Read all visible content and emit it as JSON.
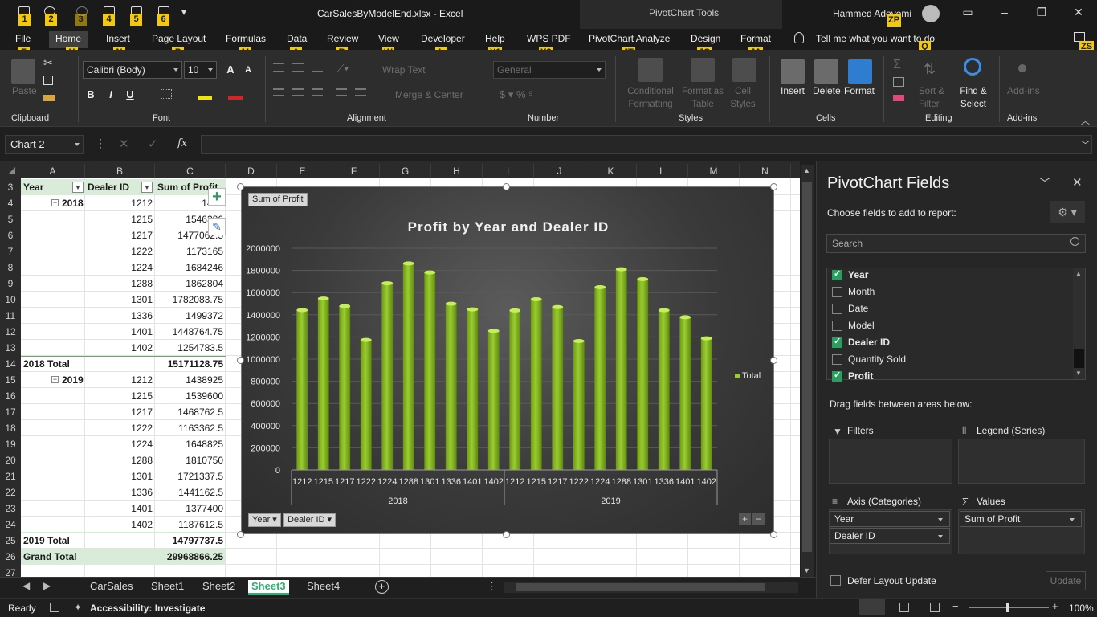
{
  "window": {
    "doc_title": "CarSalesByModelEnd.xlsx  -  Excel",
    "tools_label": "PivotChart Tools",
    "user_name": "Hammed Adeyemi",
    "qat_keytips": [
      "1",
      "2",
      "3",
      "4",
      "5",
      "6"
    ]
  },
  "tabs": [
    {
      "label": "File",
      "key": "F"
    },
    {
      "label": "Home",
      "key": "H"
    },
    {
      "label": "Insert",
      "key": "N"
    },
    {
      "label": "Page Layout",
      "key": "P"
    },
    {
      "label": "Formulas",
      "key": "M"
    },
    {
      "label": "Data",
      "key": "A"
    },
    {
      "label": "Review",
      "key": "R"
    },
    {
      "label": "View",
      "key": "W"
    },
    {
      "label": "Developer",
      "key": "L"
    },
    {
      "label": "Help",
      "key": "Y1"
    },
    {
      "label": "WPS PDF",
      "key": "Y2"
    },
    {
      "label": "PivotChart Analyze",
      "key": "JT"
    },
    {
      "label": "Design",
      "key": "JC"
    },
    {
      "label": "Format",
      "key": "JA"
    }
  ],
  "tell_me": "Tell me what you want to do",
  "keytips_extra": {
    "zp": "ZP",
    "q": "Q",
    "zs": "ZS"
  },
  "ribbon": {
    "paste": "Paste",
    "font_name": "Calibri (Body)",
    "font_size": "10",
    "wrap_text": "Wrap Text",
    "merge_center": "Merge & Center",
    "number_format": "General",
    "conditional_formatting": "Conditional Formatting",
    "format_as_table": "Format as Table",
    "cell_styles": "Cell Styles",
    "insert": "Insert",
    "delete": "Delete",
    "format": "Format",
    "sort_filter": "Sort & Filter",
    "find_select": "Find & Select",
    "add_ins": "Add-ins",
    "groups": {
      "clipboard": "Clipboard",
      "font": "Font",
      "alignment": "Alignment",
      "number": "Number",
      "styles": "Styles",
      "cells": "Cells",
      "editing": "Editing",
      "add_ins": "Add-ins"
    },
    "bold": "B",
    "italic": "I",
    "underline": "U"
  },
  "formula_bar": {
    "name_box": "Chart 2",
    "fx": "fx",
    "value": ""
  },
  "grid": {
    "columns": [
      "A",
      "B",
      "C",
      "D",
      "E",
      "F",
      "G",
      "H",
      "I",
      "J",
      "K",
      "L",
      "M",
      "N"
    ],
    "rows": [
      "3",
      "4",
      "5",
      "6",
      "7",
      "8",
      "9",
      "10",
      "11",
      "12",
      "13",
      "14",
      "15",
      "16",
      "17",
      "18",
      "19",
      "20",
      "21",
      "22",
      "23",
      "24",
      "25",
      "26",
      "27"
    ],
    "headers": {
      "year": "Year",
      "dealer_id": "Dealer ID",
      "sum_profit": "Sum of Profit"
    },
    "table": [
      {
        "a": "2018",
        "b": "1212",
        "c": "1442"
      },
      {
        "a": "",
        "b": "1215",
        "c": "1546386"
      },
      {
        "a": "",
        "b": "1217",
        "c": "1477062.5"
      },
      {
        "a": "",
        "b": "1222",
        "c": "1173165"
      },
      {
        "a": "",
        "b": "1224",
        "c": "1684246"
      },
      {
        "a": "",
        "b": "1288",
        "c": "1862804"
      },
      {
        "a": "",
        "b": "1301",
        "c": "1782083.75"
      },
      {
        "a": "",
        "b": "1336",
        "c": "1499372"
      },
      {
        "a": "",
        "b": "1401",
        "c": "1448764.75"
      },
      {
        "a": "",
        "b": "1402",
        "c": "1254783.5"
      },
      {
        "a": "2018 Total",
        "b": "",
        "c": "15171128.75"
      },
      {
        "a": "2019",
        "b": "1212",
        "c": "1438925"
      },
      {
        "a": "",
        "b": "1215",
        "c": "1539600"
      },
      {
        "a": "",
        "b": "1217",
        "c": "1468762.5"
      },
      {
        "a": "",
        "b": "1222",
        "c": "1163362.5"
      },
      {
        "a": "",
        "b": "1224",
        "c": "1648825"
      },
      {
        "a": "",
        "b": "1288",
        "c": "1810750"
      },
      {
        "a": "",
        "b": "1301",
        "c": "1721337.5"
      },
      {
        "a": "",
        "b": "1336",
        "c": "1441162.5"
      },
      {
        "a": "",
        "b": "1401",
        "c": "1377400"
      },
      {
        "a": "",
        "b": "1402",
        "c": "1187612.5"
      },
      {
        "a": "2019 Total",
        "b": "",
        "c": "14797737.5"
      },
      {
        "a": "Grand Total",
        "b": "",
        "c": "29968866.25"
      }
    ]
  },
  "chart_data": {
    "type": "bar",
    "title": "Profit by Year and Dealer ID",
    "field_button_value": "Sum of Profit",
    "axis_buttons": [
      "Year",
      "Dealer ID"
    ],
    "legend": "Total",
    "legend_position": "right",
    "groups": [
      {
        "label": "2018",
        "categories": [
          "1212",
          "1215",
          "1217",
          "1222",
          "1224",
          "1288",
          "1301",
          "1336",
          "1401",
          "1402"
        ]
      },
      {
        "label": "2019",
        "categories": [
          "1212",
          "1215",
          "1217",
          "1222",
          "1224",
          "1288",
          "1301",
          "1336",
          "1401",
          "1402"
        ]
      }
    ],
    "series": [
      {
        "name": "Total",
        "values": [
          1442000,
          1546386,
          1477062.5,
          1173165,
          1684246,
          1862804,
          1782083.75,
          1499372,
          1448764.75,
          1254783.5,
          1438925,
          1539600,
          1468762.5,
          1163362.5,
          1648825,
          1810750,
          1721337.5,
          1441162.5,
          1377400,
          1187612.5
        ]
      }
    ],
    "ylim": [
      0,
      2000000
    ],
    "yticks": [
      "0",
      "200000",
      "400000",
      "600000",
      "800000",
      "1000000",
      "1200000",
      "1400000",
      "1600000",
      "1800000",
      "2000000"
    ],
    "grid": true,
    "bar_color": "#9acd32"
  },
  "sheets": [
    "CarSales",
    "Sheet1",
    "Sheet2",
    "Sheet3",
    "Sheet4"
  ],
  "active_sheet": "Sheet3",
  "status": {
    "ready": "Ready",
    "accessibility": "Accessibility: Investigate",
    "zoom": "100%"
  },
  "pane": {
    "title": "PivotChart Fields",
    "subtitle": "Choose fields to add to report:",
    "search_placeholder": "Search",
    "fields": [
      {
        "name": "Year",
        "checked": true
      },
      {
        "name": "Month",
        "checked": false
      },
      {
        "name": "Date",
        "checked": false
      },
      {
        "name": "Model",
        "checked": false
      },
      {
        "name": "Dealer ID",
        "checked": true
      },
      {
        "name": "Quantity Sold",
        "checked": false
      },
      {
        "name": "Profit",
        "checked": true
      }
    ],
    "drag_label": "Drag fields between areas below:",
    "areas": {
      "filters": "Filters",
      "legend": "Legend (Series)",
      "axis": "Axis (Categories)",
      "values": "Values"
    },
    "axis_items": [
      "Year",
      "Dealer ID"
    ],
    "value_items": [
      "Sum of Profit"
    ],
    "defer": "Defer Layout Update",
    "update": "Update"
  }
}
